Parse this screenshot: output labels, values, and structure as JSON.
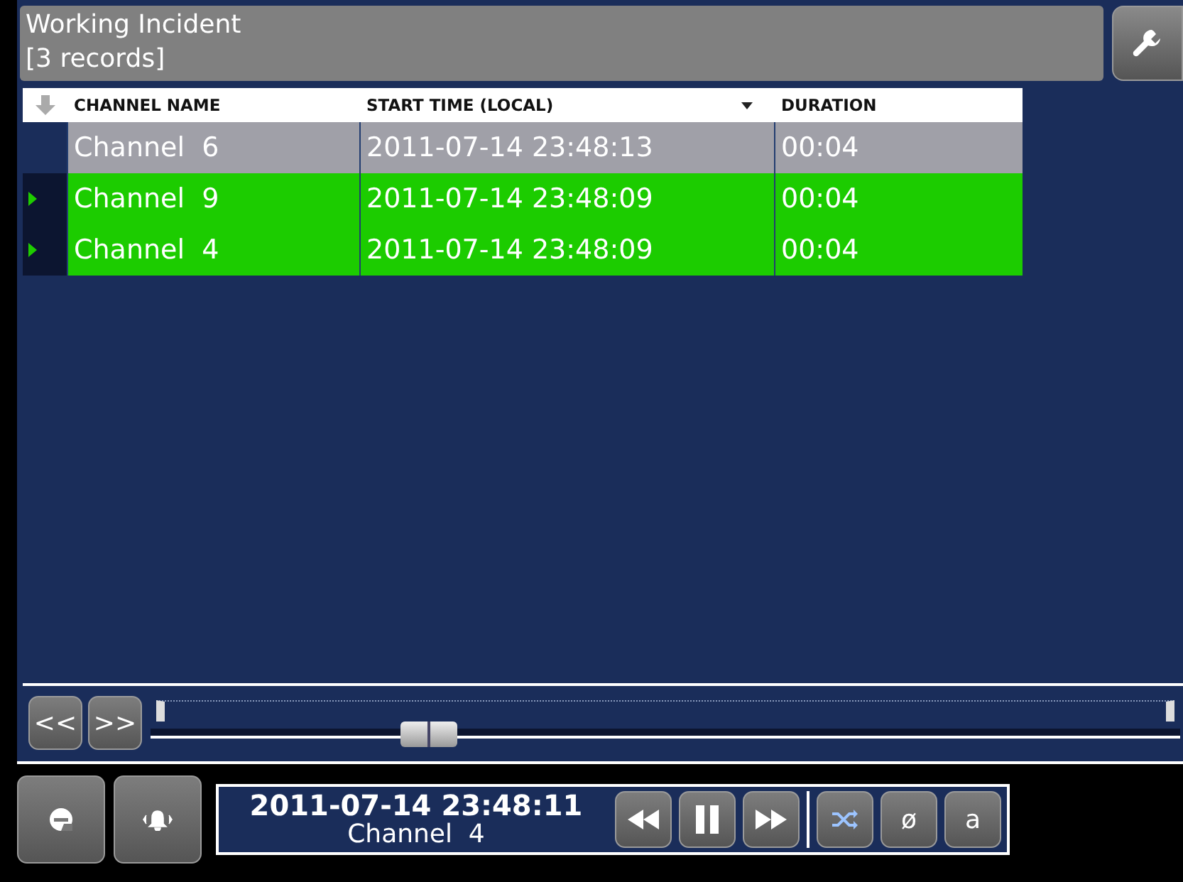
{
  "header": {
    "title": "Working Incident",
    "subtitle": "[3 records]"
  },
  "table": {
    "columns": [
      {
        "label": "CHANNEL NAME",
        "sorted": false
      },
      {
        "label": "START TIME (LOCAL)",
        "sorted": true
      },
      {
        "label": "DURATION",
        "sorted": false
      }
    ],
    "rows": [
      {
        "cells": [
          "Channel  6",
          "2011-07-14 23:48:13",
          "00:04"
        ],
        "selected": true,
        "playing": false
      },
      {
        "cells": [
          "Channel  9",
          "2011-07-14 23:48:09",
          "00:04"
        ],
        "selected": false,
        "playing": true
      },
      {
        "cells": [
          "Channel  4",
          "2011-07-14 23:48:09",
          "00:04"
        ],
        "selected": false,
        "playing": true
      }
    ]
  },
  "timeline": {
    "back_label": "<<",
    "forward_label": ">>",
    "level": 0.27
  },
  "player": {
    "timestamp": "2011-07-14 23:48:11",
    "channel": "Channel  4",
    "null_label": "ø",
    "a_label": "a"
  }
}
